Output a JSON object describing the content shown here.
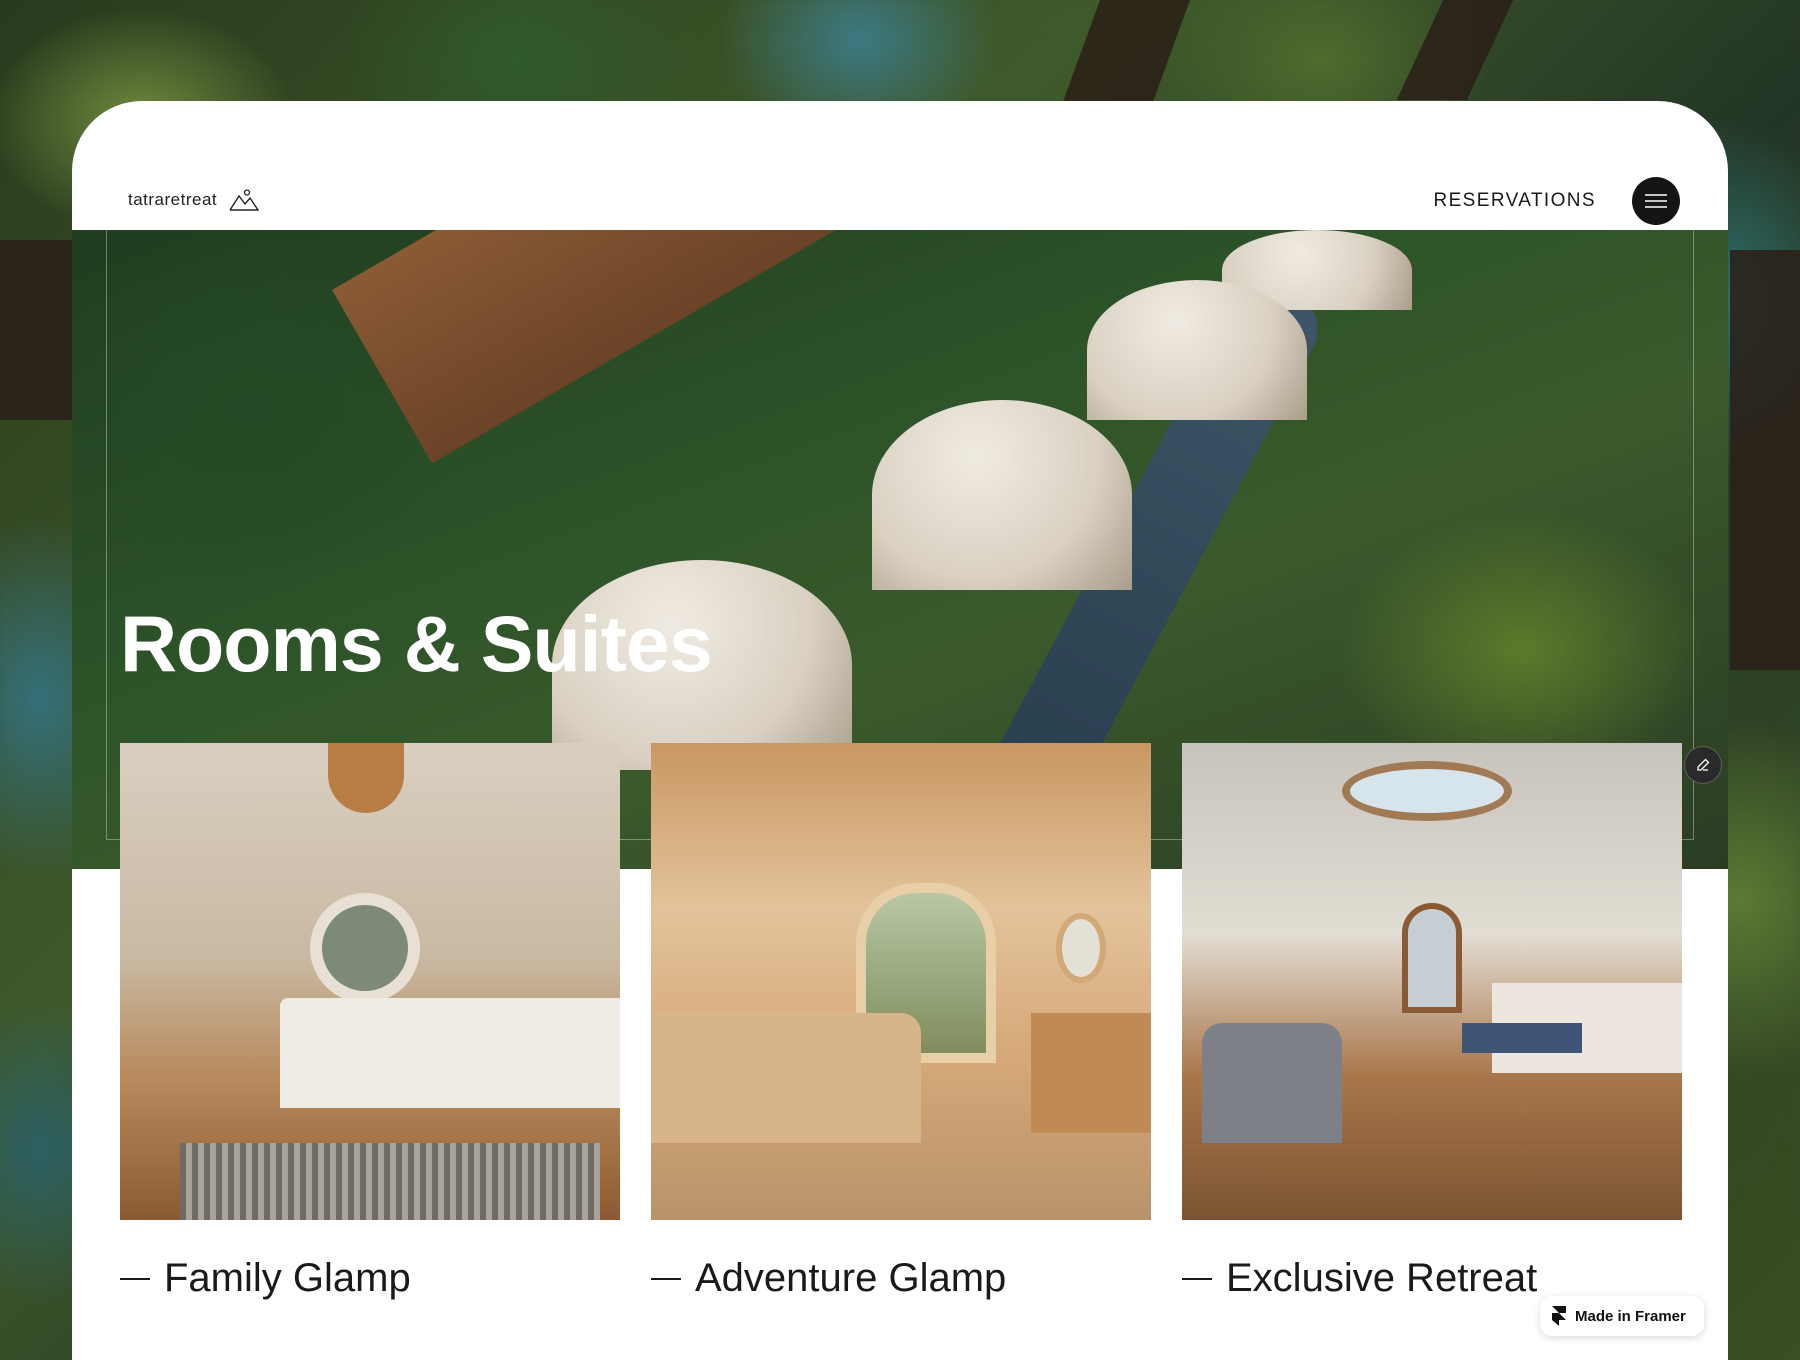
{
  "nav": {
    "logo_text": "tatraretreat",
    "reservations_label": "RESERVATIONS",
    "menu_icon": "hamburger-icon"
  },
  "hero": {
    "title": "Rooms & Suites"
  },
  "cards": [
    {
      "label": "Family Glamp"
    },
    {
      "label": "Adventure Glamp"
    },
    {
      "label": "Exclusive Retreat"
    }
  ],
  "badge": {
    "label": "Made in Framer",
    "icon": "framer-logo-icon"
  },
  "colors": {
    "text": "#1a1a1a",
    "menu_button": "#141414",
    "background": "#ffffff"
  }
}
